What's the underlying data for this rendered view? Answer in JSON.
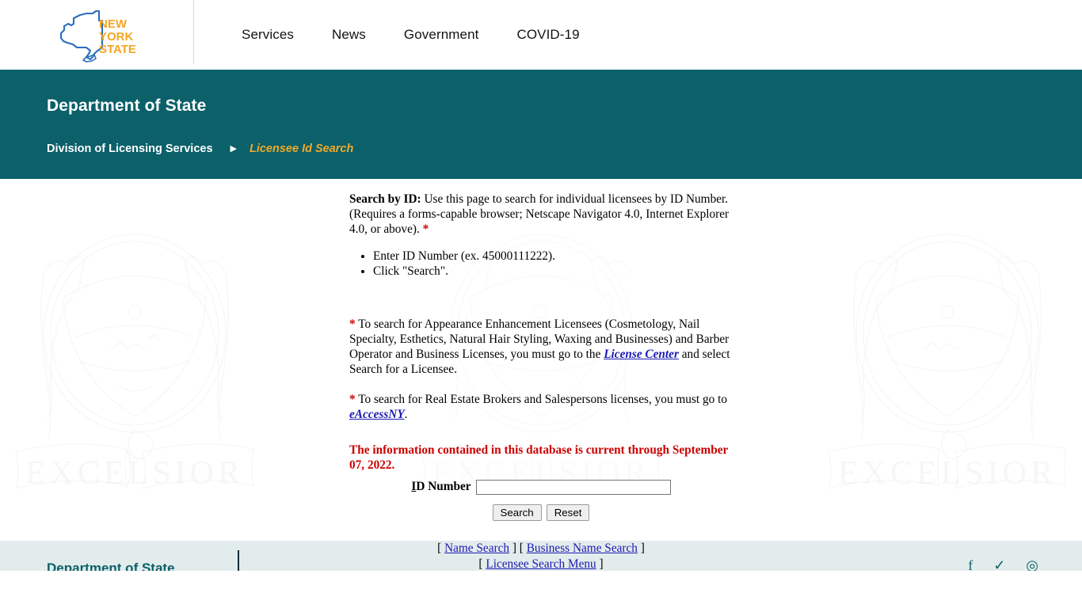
{
  "header": {
    "logo_alt": "New York State",
    "logo_line1": "NEW",
    "logo_line2": "YORK",
    "logo_line3": "STATE",
    "nav": [
      {
        "label": "Services",
        "name": "nav-services"
      },
      {
        "label": "News",
        "name": "nav-news"
      },
      {
        "label": "Government",
        "name": "nav-government"
      },
      {
        "label": "COVID-19",
        "name": "nav-covid19"
      }
    ]
  },
  "agency": {
    "title": "Department of State",
    "breadcrumb_parent": "Division of Licensing Services",
    "breadcrumb_arrow": "▶",
    "breadcrumb_current": "Licensee Id Search",
    "band_color": "#0b6069",
    "accent_color": "#f0a92a"
  },
  "main": {
    "intro_label": "Search by ID:",
    "intro_text": " Use this page to search for individual licensees by ID Number. (Requires a forms-capable browser; Netscape Navigator 4.0, Internet Explorer 4.0, or above). ",
    "intro_star": "*",
    "steps": [
      "Enter ID Number (ex. 45000111222).",
      "Click \"Search\"."
    ],
    "note1_star": "*",
    "note1_part1": " To search for Appearance Enhancement Licensees (Cosmetology, Nail Specialty, Esthetics, Natural Hair Styling, Waxing and Businesses) and Barber Operator and Business Licenses, you must go to the ",
    "note1_link": "License Center",
    "note1_part2": " and select Search for a Licensee.",
    "note2_star": "*",
    "note2_part1": " To search for Real Estate Brokers and Salespersons licenses, you must go to ",
    "note2_link": "eAccessNY",
    "note2_part2": ".",
    "db_current": "The information contained in this database is current through September 07, 2022.",
    "db_current_color": "#cc0000",
    "form": {
      "label_accesskey": "I",
      "label_rest": "D Number",
      "id_value": "",
      "id_placeholder": "",
      "search_button": "Search",
      "reset_button": "Reset"
    },
    "bottom_links": {
      "open_bracket": "[",
      "close_bracket": "]",
      "name_search": "Name Search",
      "business_name_search": "Business Name Search",
      "licensee_search_menu": "Licensee Search Menu"
    },
    "watermark_text": "EXCELSIOR"
  },
  "footer": {
    "agency_name": "Department of State",
    "social": [
      {
        "name": "facebook-icon",
        "glyph": "f"
      },
      {
        "name": "twitter-icon",
        "glyph": "✓"
      },
      {
        "name": "instagram-icon",
        "glyph": "◎"
      }
    ],
    "background_color": "#e3ecec"
  }
}
